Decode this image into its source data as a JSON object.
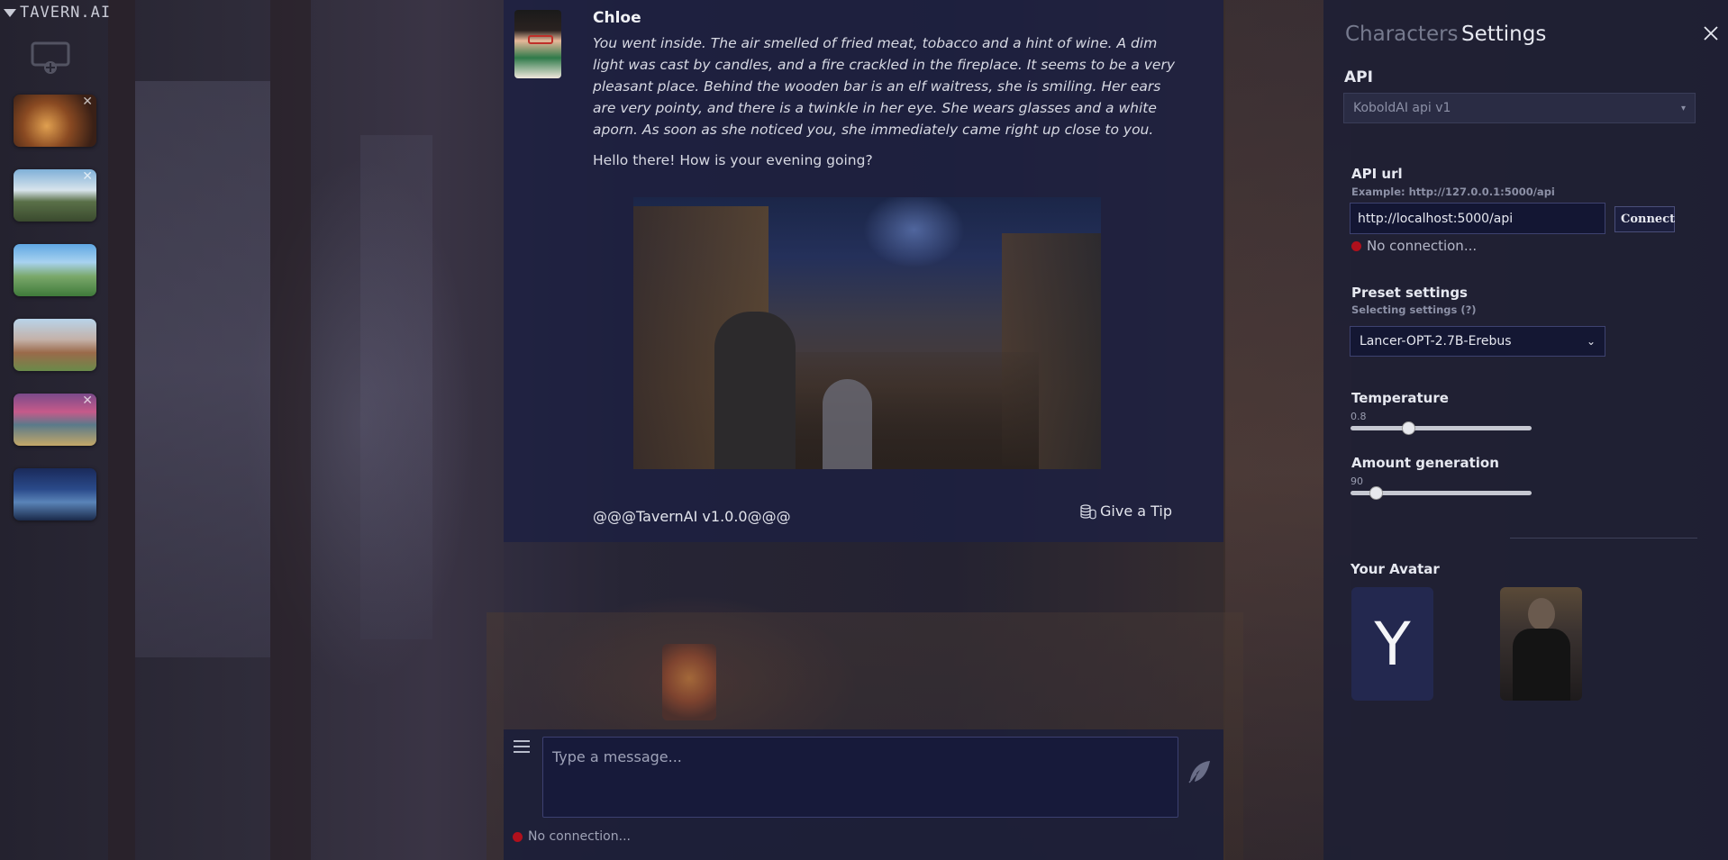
{
  "app": {
    "logo_text": "TAVERN.AI"
  },
  "sidebar": {
    "characters": [
      {
        "thumb": "tavern-interior"
      },
      {
        "thumb": "mountain-village"
      },
      {
        "thumb": "green-valley"
      },
      {
        "thumb": "market-street"
      },
      {
        "thumb": "purple-sky-lake"
      },
      {
        "thumb": "night-city"
      }
    ]
  },
  "chat": {
    "message": {
      "name": "Chloe",
      "narration": "You went inside. The air smelled of fried meat, tobacco and a hint of wine. A dim light was cast by candles, and a fire crackled in the fireplace. It seems to be a very pleasant place. Behind the wooden bar is an elf waitress, she is smiling. Her ears are very pointy, and there is a twinkle in her eye. She wears glasses and a white aporn. As soon as she noticed you, she immediately came right up close to you.",
      "speech": "Hello there! How is your evening going?"
    },
    "version": "@@@TavernAI v1.0.0@@@",
    "tip_label": "Give a Tip",
    "input_placeholder": "Type a message...",
    "status": "No connection..."
  },
  "panel": {
    "tabs": {
      "characters": "Characters",
      "settings": "Settings"
    },
    "api": {
      "label": "API",
      "selected": "KoboldAI api v1"
    },
    "api_url": {
      "label": "API url",
      "example": "Example: http://127.0.0.1:5000/api",
      "value": "http://localhost:5000/api",
      "connect_label": "Connect",
      "status": "No connection..."
    },
    "preset": {
      "label": "Preset settings",
      "hint": "Selecting settings (?)",
      "selected": "Lancer-OPT-2.7B-Erebus"
    },
    "temperature": {
      "label": "Temperature",
      "value": "0.8",
      "fraction": 0.32
    },
    "amount_generation": {
      "label": "Amount generation",
      "value": "90",
      "fraction": 0.14
    },
    "avatar": {
      "label": "Your Avatar",
      "letter": "Y"
    }
  },
  "colors": {
    "status_red": "#b0101c",
    "chat_bg": "#1c2042",
    "panel_bg": "#1e1f34"
  }
}
